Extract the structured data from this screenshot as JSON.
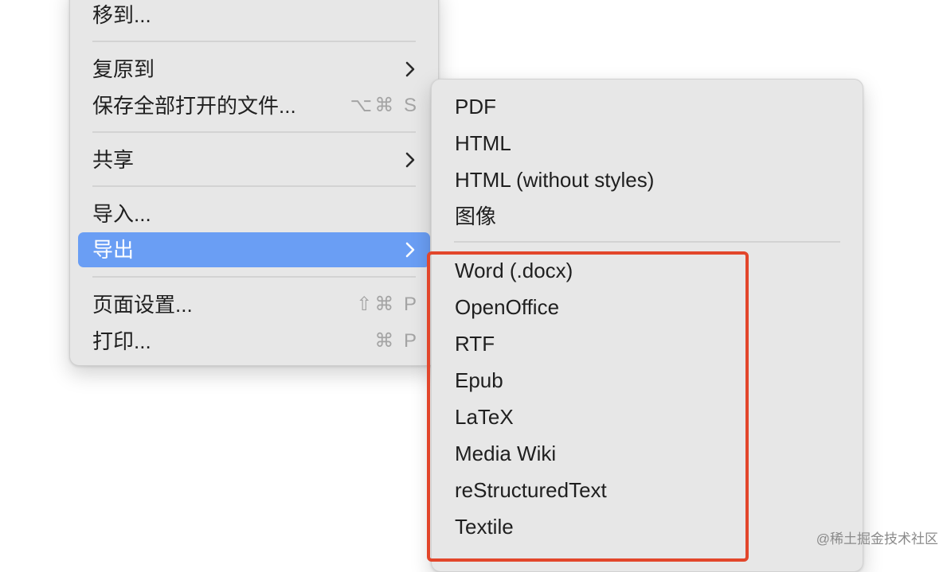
{
  "main_menu": {
    "move_to": "移到...",
    "revert_to": "复原到",
    "save_all": "保存全部打开的文件...",
    "save_all_shortcut": "⌥⌘ S",
    "share": "共享",
    "import": "导入...",
    "export": "导出",
    "page_setup": "页面设置...",
    "page_setup_shortcut": "⇧⌘ P",
    "print": "打印...",
    "print_shortcut": "⌘ P"
  },
  "export_submenu": {
    "items_top": [
      "PDF",
      "HTML",
      "HTML (without styles)",
      "图像"
    ],
    "items_bottom": [
      "Word (.docx)",
      "OpenOffice",
      "RTF",
      "Epub",
      "LaTeX",
      "Media Wiki",
      "reStructuredText",
      "Textile"
    ]
  },
  "colors": {
    "highlight": "#6a9ef4",
    "annotation": "#e2462b",
    "menu_bg": "#e7e7e7"
  },
  "icons": {
    "submenu_arrow": "chevron-right-icon"
  },
  "watermark": "@稀土掘金技术社区"
}
